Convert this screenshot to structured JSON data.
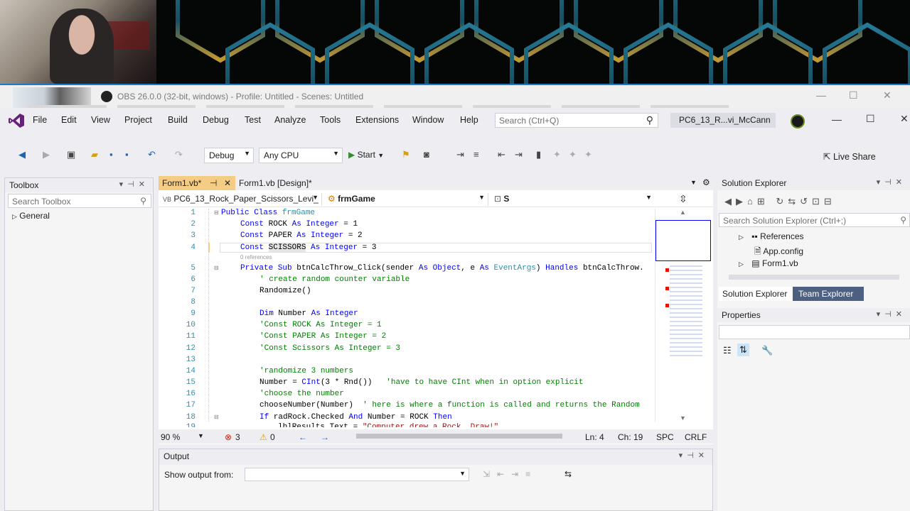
{
  "obs": {
    "title": "OBS 26.0.0 (32-bit, windows) - Profile: Untitled - Scenes: Untitled"
  },
  "menu": {
    "items": [
      "File",
      "Edit",
      "View",
      "Project",
      "Build",
      "Debug",
      "Test",
      "Analyze",
      "Tools",
      "Extensions",
      "Window",
      "Help"
    ],
    "search_placeholder": "Search (Ctrl+Q)",
    "solution_name": "PC6_13_R...vi_McCann"
  },
  "toolbar": {
    "config": "Debug",
    "platform": "Any CPU",
    "start_label": "Start",
    "live_share_label": "Live Share"
  },
  "toolbox": {
    "title": "Toolbox",
    "search_placeholder": "Search Toolbox",
    "group": "General"
  },
  "editor": {
    "tabs": [
      {
        "label": "Form1.vb*",
        "active": true
      },
      {
        "label": "Form1.vb [Design]*",
        "active": false
      }
    ],
    "nav": {
      "project": "PC6_13_Rock_Paper_Scissors_Levi_",
      "class": "frmGame",
      "member": "S"
    },
    "ref_hint": "0 references",
    "lines": [
      {
        "n": "1",
        "text": "Public Class frmGame"
      },
      {
        "n": "2",
        "text": "Const ROCK As Integer = 1"
      },
      {
        "n": "3",
        "text": "Const PAPER As Integer = 2"
      },
      {
        "n": "4",
        "text": "Const SCISSORS As Integer = 3"
      },
      {
        "n": "5",
        "text": "Private Sub btnCalcThrow_Click(sender As Object, e As EventArgs) Handles btnCalcThrow."
      },
      {
        "n": "6",
        "text": "' create random counter variable"
      },
      {
        "n": "7",
        "text": "Randomize()"
      },
      {
        "n": "8",
        "text": ""
      },
      {
        "n": "9",
        "text": "Dim Number As Integer"
      },
      {
        "n": "10",
        "text": "'Const ROCK As Integer = 1"
      },
      {
        "n": "11",
        "text": "'Const PAPER As Integer = 2"
      },
      {
        "n": "12",
        "text": "'Const Scissors As Integer = 3"
      },
      {
        "n": "13",
        "text": ""
      },
      {
        "n": "14",
        "text": "'randomize 3 numbers"
      },
      {
        "n": "15",
        "text": "Number = CInt(3 * Rnd())   'have to have CInt when in option explicit"
      },
      {
        "n": "16",
        "text": "'choose the number"
      },
      {
        "n": "17",
        "text": "chooseNumber(Number)  ' here is where a function is called and returns the Random"
      },
      {
        "n": "18",
        "text": "If radRock.Checked And Number = ROCK Then"
      },
      {
        "n": "19",
        "text": "lblResults.Text = \"Computer drew a Rock. Draw!\""
      }
    ],
    "status": {
      "zoom": "90 %",
      "errors": "3",
      "warnings": "0",
      "ln": "Ln: 4",
      "ch": "Ch: 19",
      "spc": "SPC",
      "crlf": "CRLF"
    }
  },
  "solution_explorer": {
    "title": "Solution Explorer",
    "search_placeholder": "Search Solution Explorer (Ctrl+;)",
    "items": [
      "References",
      "App.config",
      "Form1.vb"
    ],
    "tabs": [
      "Solution Explorer",
      "Team Explorer"
    ]
  },
  "properties": {
    "title": "Properties"
  },
  "output": {
    "title": "Output",
    "show_from_label": "Show output from:"
  }
}
